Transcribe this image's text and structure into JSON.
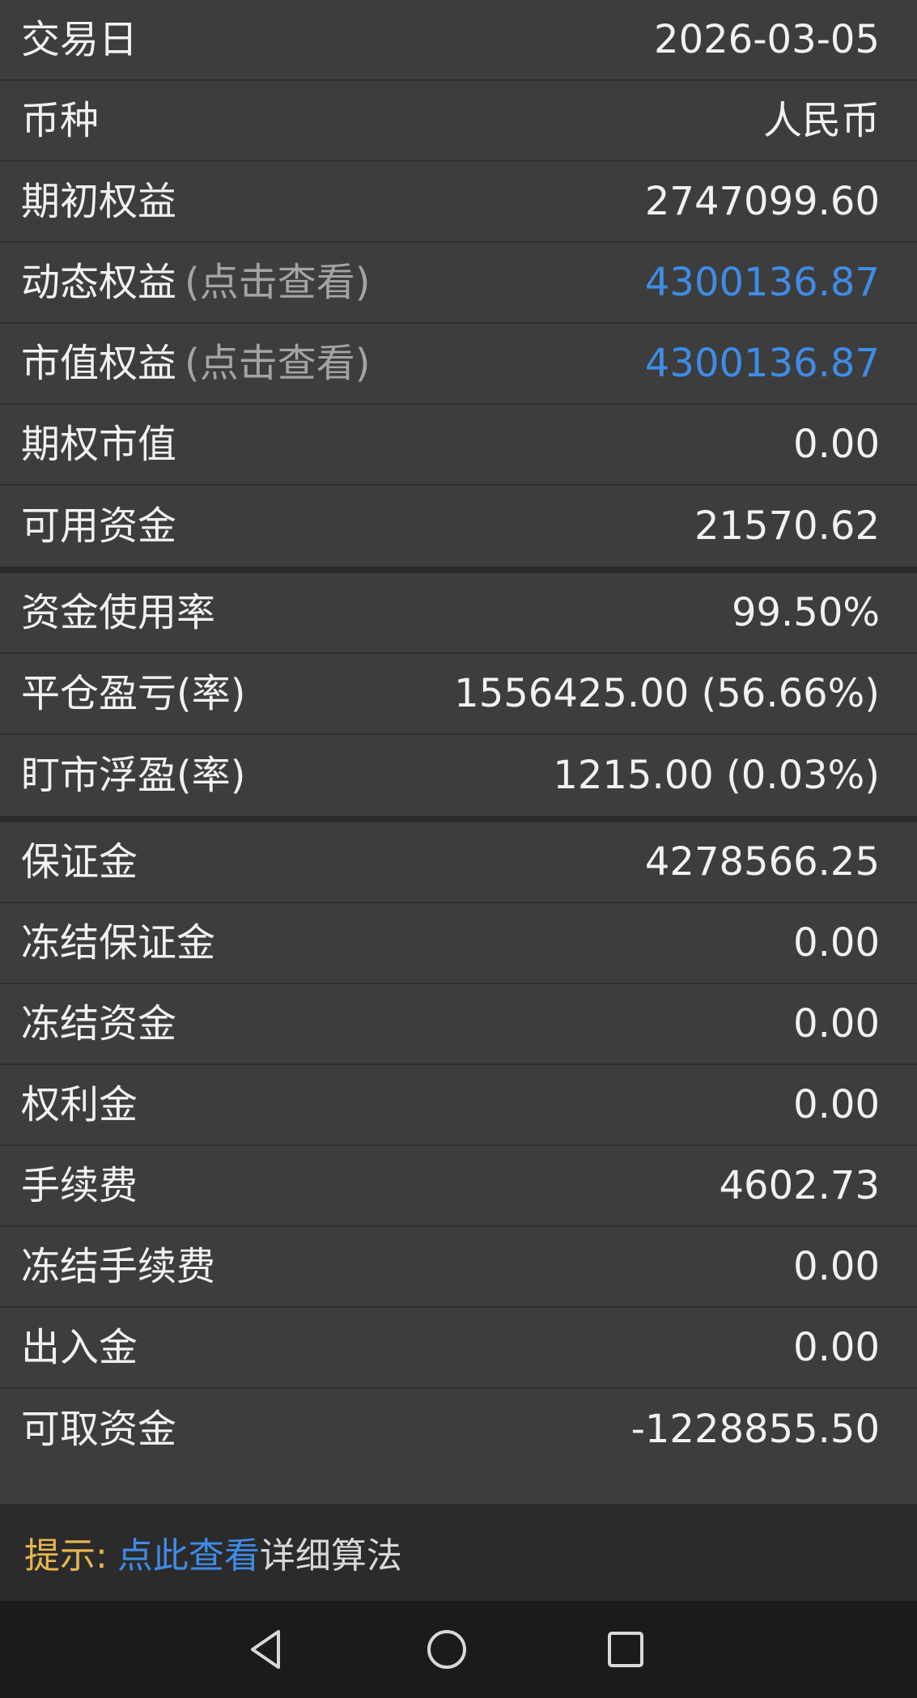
{
  "rows_group1": [
    {
      "label": "交易日",
      "hint": "",
      "value": "2026-03-05",
      "link": false
    },
    {
      "label": "币种",
      "hint": "",
      "value": "人民币",
      "link": false
    },
    {
      "label": "期初权益",
      "hint": "",
      "value": "2747099.60",
      "link": false
    },
    {
      "label": "动态权益",
      "hint": "(点击查看)",
      "value": "4300136.87",
      "link": true
    },
    {
      "label": "市值权益",
      "hint": "(点击查看)",
      "value": "4300136.87",
      "link": true
    },
    {
      "label": "期权市值",
      "hint": "",
      "value": "0.00",
      "link": false
    },
    {
      "label": "可用资金",
      "hint": "",
      "value": "21570.62",
      "link": false
    }
  ],
  "rows_group2": [
    {
      "label": "资金使用率",
      "hint": "",
      "value": "99.50%",
      "link": false
    },
    {
      "label": "平仓盈亏(率)",
      "hint": "",
      "value": "1556425.00 (56.66%)",
      "link": false
    },
    {
      "label": "盯市浮盈(率)",
      "hint": "",
      "value": "1215.00 (0.03%)",
      "link": false
    }
  ],
  "rows_group3": [
    {
      "label": "保证金",
      "hint": "",
      "value": "4278566.25",
      "link": false
    },
    {
      "label": "冻结保证金",
      "hint": "",
      "value": "0.00",
      "link": false
    },
    {
      "label": "冻结资金",
      "hint": "",
      "value": "0.00",
      "link": false
    },
    {
      "label": "权利金",
      "hint": "",
      "value": "0.00",
      "link": false
    },
    {
      "label": "手续费",
      "hint": "",
      "value": "4602.73",
      "link": false
    },
    {
      "label": "冻结手续费",
      "hint": "",
      "value": "0.00",
      "link": false
    },
    {
      "label": "出入金",
      "hint": "",
      "value": "0.00",
      "link": false
    },
    {
      "label": "可取资金",
      "hint": "",
      "value": "-1228855.50",
      "link": false
    }
  ],
  "tip": {
    "prefix": "提示:",
    "link": "点此查看",
    "rest": "详细算法"
  },
  "nav": {
    "back_icon": "back-triangle-icon",
    "home_icon": "home-circle-icon",
    "recents_icon": "recents-square-icon"
  },
  "colors": {
    "background": "#3d3d3d",
    "link": "#3f8ce8",
    "tip_prefix": "#e6b54f",
    "navbar": "#1b1b1b"
  }
}
